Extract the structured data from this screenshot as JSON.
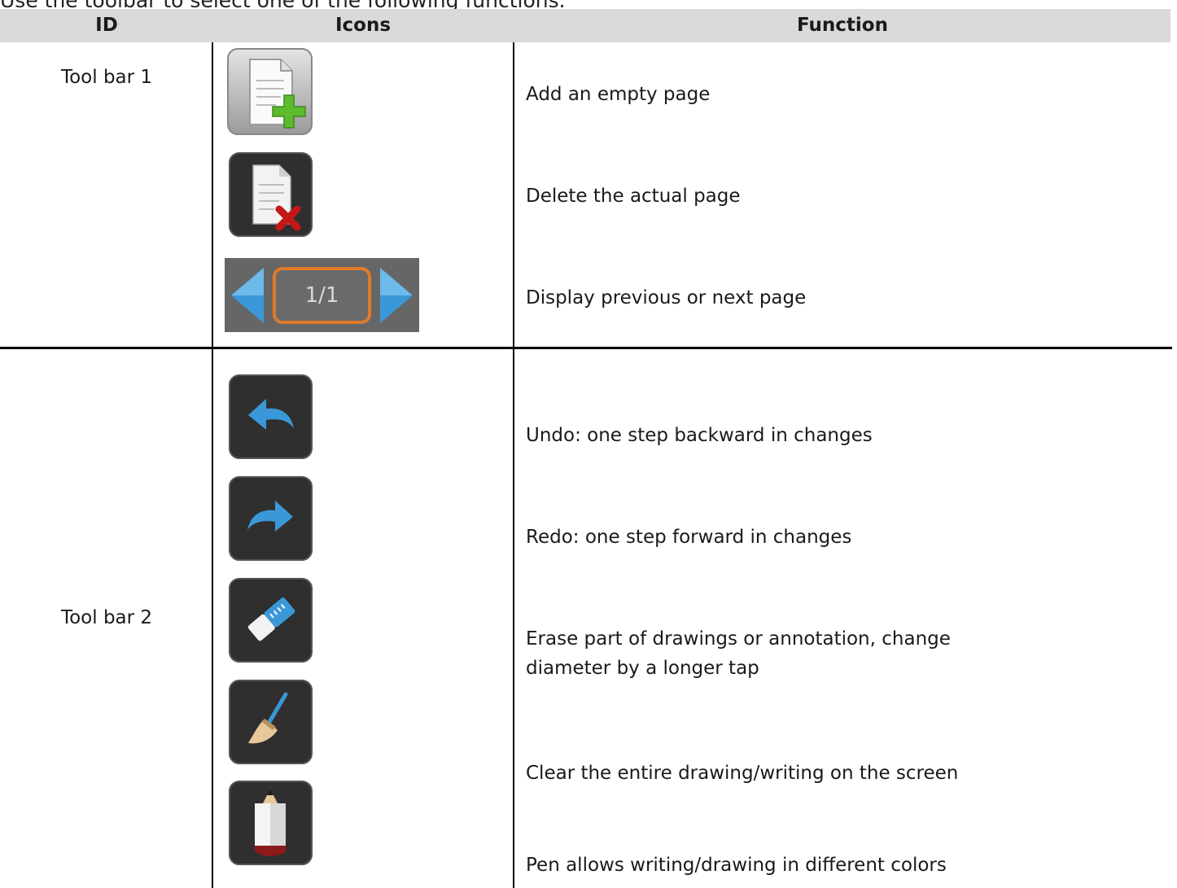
{
  "intro": "Use the toolbar to select one of the following functions.",
  "table": {
    "headers": {
      "id": "ID",
      "icons": "Icons",
      "function": "Function"
    },
    "groups": [
      {
        "id": "Tool bar 1",
        "rows": [
          {
            "icon": "add-page-icon",
            "function": "Add an empty page"
          },
          {
            "icon": "delete-page-icon",
            "function": "Delete the actual page"
          },
          {
            "icon": "page-navigation-icon",
            "page_indicator": "1/1",
            "function": "Display previous or next page"
          }
        ]
      },
      {
        "id": "Tool bar 2",
        "rows": [
          {
            "icon": "undo-icon",
            "function": "Undo: one step backward in changes"
          },
          {
            "icon": "redo-icon",
            "function": "Redo: one step forward in changes"
          },
          {
            "icon": "eraser-icon",
            "function": "Erase part of drawings or annotation, change diameter by a longer tap"
          },
          {
            "icon": "broom-icon",
            "function": "Clear the entire drawing/writing on the screen"
          },
          {
            "icon": "pencil-icon",
            "function": "Pen allows writing/drawing in different colors"
          }
        ]
      }
    ]
  }
}
